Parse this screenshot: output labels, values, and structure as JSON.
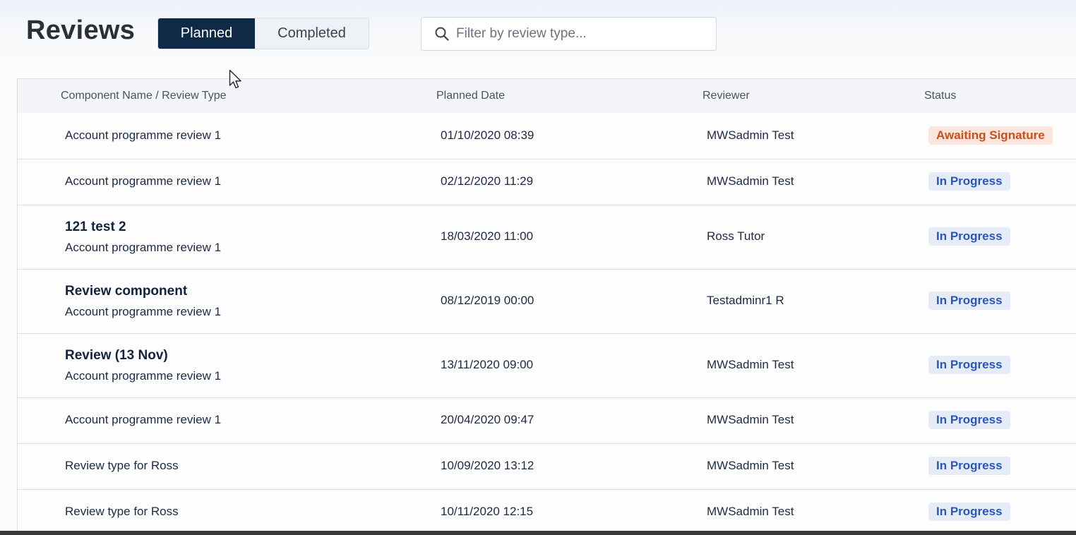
{
  "header": {
    "title": "Reviews",
    "tabs": [
      {
        "label": "Planned",
        "active": true
      },
      {
        "label": "Completed",
        "active": false
      }
    ],
    "search": {
      "placeholder": "Filter by review type...",
      "value": "",
      "icon": "search-icon"
    }
  },
  "table": {
    "columns": [
      "Component Name / Review Type",
      "Planned Date",
      "Reviewer",
      "Status"
    ],
    "rows": [
      {
        "component": "",
        "review_type": "Account programme review 1",
        "date": "01/10/2020 08:39",
        "reviewer": "MWSadmin Test",
        "status": "Awaiting Signature"
      },
      {
        "component": "",
        "review_type": "Account programme review 1",
        "date": "02/12/2020 11:29",
        "reviewer": "MWSadmin Test",
        "status": "In Progress"
      },
      {
        "component": "121 test 2",
        "review_type": "Account programme review 1",
        "date": "18/03/2020 11:00",
        "reviewer": "Ross Tutor",
        "status": "In Progress"
      },
      {
        "component": "Review component",
        "review_type": "Account programme review 1",
        "date": "08/12/2019 00:00",
        "reviewer": "Testadminr1 R",
        "status": "In Progress"
      },
      {
        "component": "Review (13 Nov)",
        "review_type": "Account programme review 1",
        "date": "13/11/2020 09:00",
        "reviewer": "MWSadmin Test",
        "status": "In Progress"
      },
      {
        "component": "",
        "review_type": "Account programme review 1",
        "date": "20/04/2020 09:47",
        "reviewer": "MWSadmin Test",
        "status": "In Progress"
      },
      {
        "component": "",
        "review_type": "Review type for Ross",
        "date": "10/09/2020 13:12",
        "reviewer": "MWSadmin Test",
        "status": "In Progress"
      },
      {
        "component": "",
        "review_type": "Review type for Ross",
        "date": "10/11/2020 12:15",
        "reviewer": "MWSadmin Test",
        "status": "In Progress"
      }
    ]
  },
  "colors": {
    "active_tab_bg": "#0f2a47",
    "in_progress_text": "#2a56b8",
    "in_progress_bg": "#e5ecf8",
    "awaiting_text": "#c7501c",
    "awaiting_bg": "#fbe6dd"
  }
}
